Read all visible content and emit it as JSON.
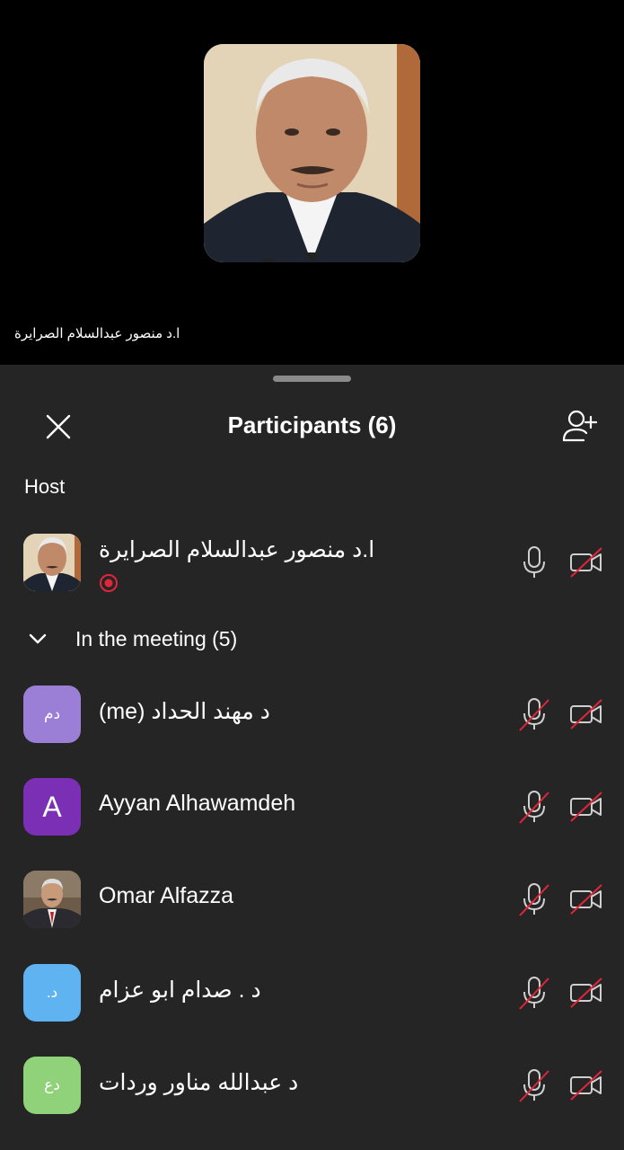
{
  "stage": {
    "speaker_name": "ا.د منصور عبدالسلام الصرايرة"
  },
  "panel": {
    "title": "Participants (6)",
    "close_icon": "close-icon",
    "add_icon": "add-person-icon",
    "host_section_label": "Host",
    "group_label": "In the meeting (5)"
  },
  "host": {
    "name": "ا.د منصور عبدالسلام الصرايرة",
    "mic": "mic-on",
    "camera": "camera-off",
    "recording": true
  },
  "participants": [
    {
      "name": "د مهند الحداد (me)",
      "initials": "دم",
      "avatar_color": "#9b7fd6",
      "mic": "mic-off",
      "camera": "camera-off"
    },
    {
      "name": "Ayyan Alhawamdeh",
      "initials": "A",
      "avatar_color": "#7b2fb5",
      "mic": "mic-off",
      "camera": "camera-off"
    },
    {
      "name": "Omar Alfazza",
      "initials": "",
      "avatar_color": "#5a4b40",
      "mic": "mic-off",
      "camera": "camera-off"
    },
    {
      "name": "د . صدام ابو عزام",
      "initials": "د.",
      "avatar_color": "#5eb3f0",
      "mic": "mic-off",
      "camera": "camera-off"
    },
    {
      "name": "د عبدالله مناور وردات",
      "initials": "دع",
      "avatar_color": "#8fd27a",
      "mic": "mic-off",
      "camera": "camera-off"
    }
  ],
  "colors": {
    "sheet_bg": "#252525",
    "muted_slash": "#e0263b",
    "record": "#e0263b"
  }
}
